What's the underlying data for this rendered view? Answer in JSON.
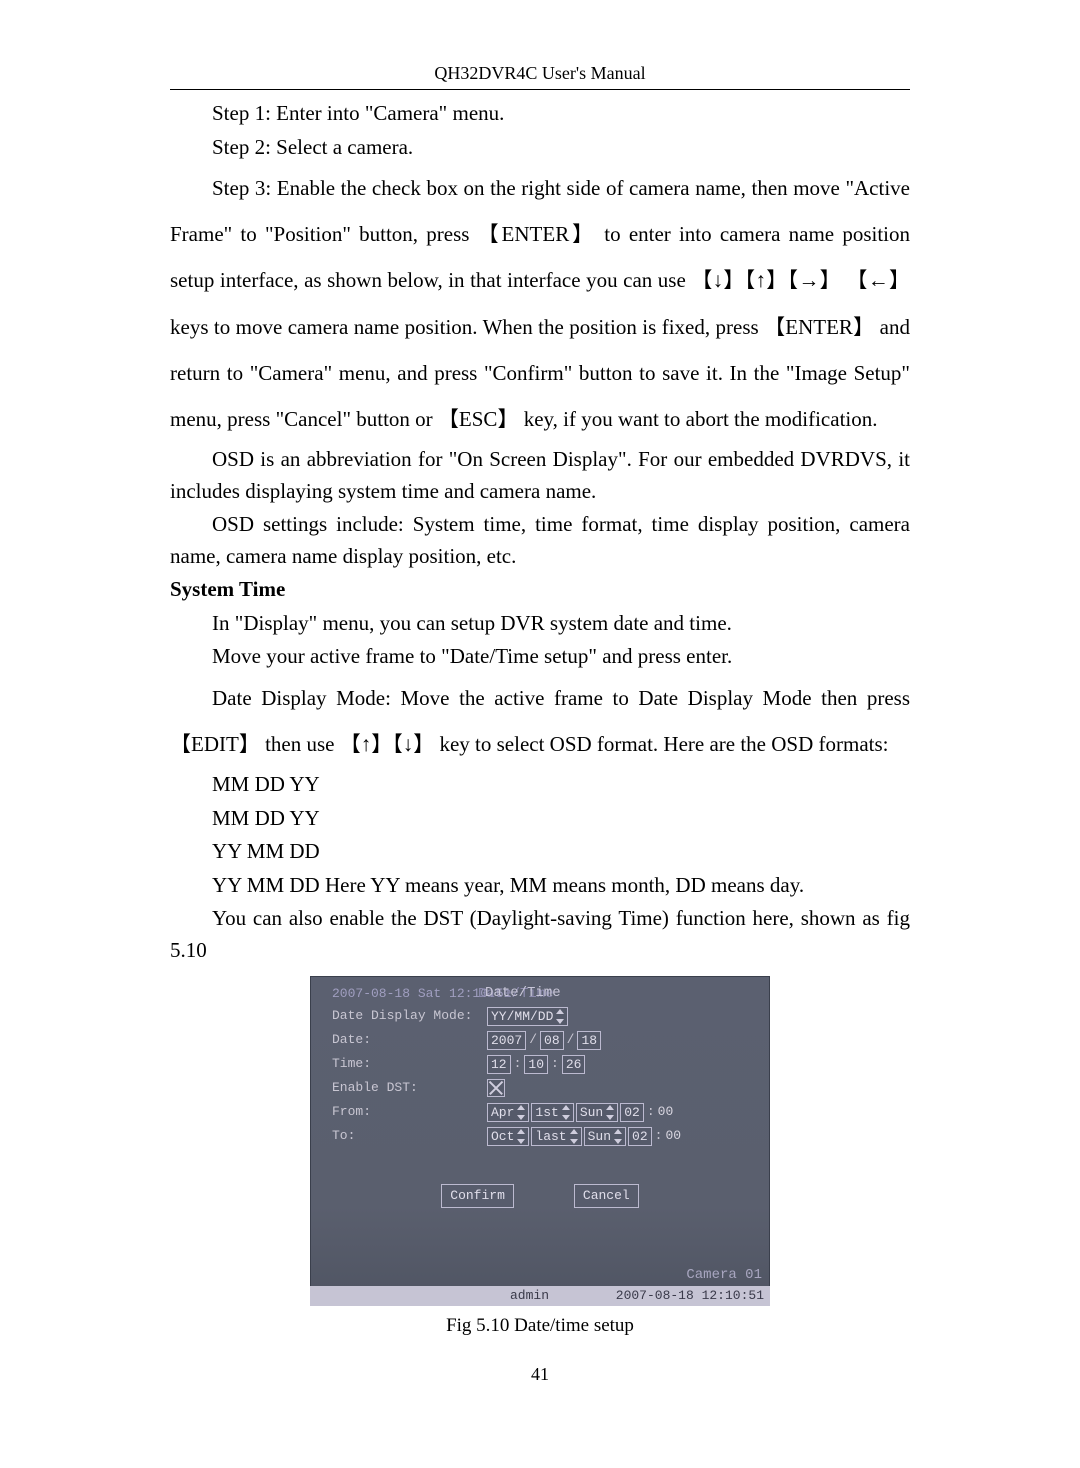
{
  "header": "QH32DVR4C User's Manual",
  "body": {
    "step1": "Step 1: Enter into \"Camera\" menu.",
    "step2": "Step 2: Select a camera.",
    "step3": "Step 3: Enable the check box on the right side of camera name, then move \"Active Frame\" to \"Position\" button, press 【ENTER】 to enter into camera name position setup interface, as shown below, in that interface you can use 【↓】【↑】【→】 【←】 keys to move camera name position. When the position is fixed, press 【ENTER】 and return to \"Camera\" menu, and press \"Confirm\" button to save it. In the \"Image Setup\" menu, press \"Cancel\" button or 【ESC】 key, if you want to abort the modification.",
    "osd1": "OSD is an abbreviation for \"On Screen Display\". For our embedded DVRDVS, it includes displaying system time and camera name.",
    "osd2": "OSD settings include: System time, time format, time display position, camera name, camera name display position, etc.",
    "system_time_h": "System Time",
    "st1": "In \"Display\" menu, you can setup DVR system date and time.",
    "st2": "Move your active frame to \"Date/Time setup\" and press enter.",
    "st3": "Date Display Mode: Move the active frame to Date Display Mode then press 【EDIT】   then use 【↑】【↓】 key to select OSD format. Here are the OSD formats:",
    "fmt1": "MM DD YY",
    "fmt2": "MM DD YY",
    "fmt3": "YY MM DD",
    "fmt4": "YY MM DD Here YY means year, MM means month, DD means day.",
    "dst": "You can also enable the DST (Daylight-saving Time) function here, shown as fig 5.10"
  },
  "screen": {
    "top_date": "2007-08-18 Sat 12:10:51",
    "title": "Date/Time",
    "labels": {
      "mode": "Date Display Mode:",
      "date": "Date:",
      "time": "Time:",
      "dst": "Enable DST:",
      "from": "From:",
      "to": "To:"
    },
    "mode_value": "YY/MM/DD",
    "date": {
      "y": "2007",
      "m": "08",
      "d": "18"
    },
    "time": {
      "h": "12",
      "m": "10",
      "s": "26"
    },
    "from": {
      "month": "Apr",
      "week": "1st",
      "day": "Sun",
      "hour": "02",
      "min": "00"
    },
    "to": {
      "month": "Oct",
      "week": "last",
      "day": "Sun",
      "hour": "02",
      "min": "00"
    },
    "confirm": "Confirm",
    "cancel": "Cancel",
    "camera": "Camera 01",
    "admin": "admin",
    "timestamp": "2007-08-18 12:10:51"
  },
  "caption": "Fig 5.10 Date/time setup",
  "page_number": "41"
}
